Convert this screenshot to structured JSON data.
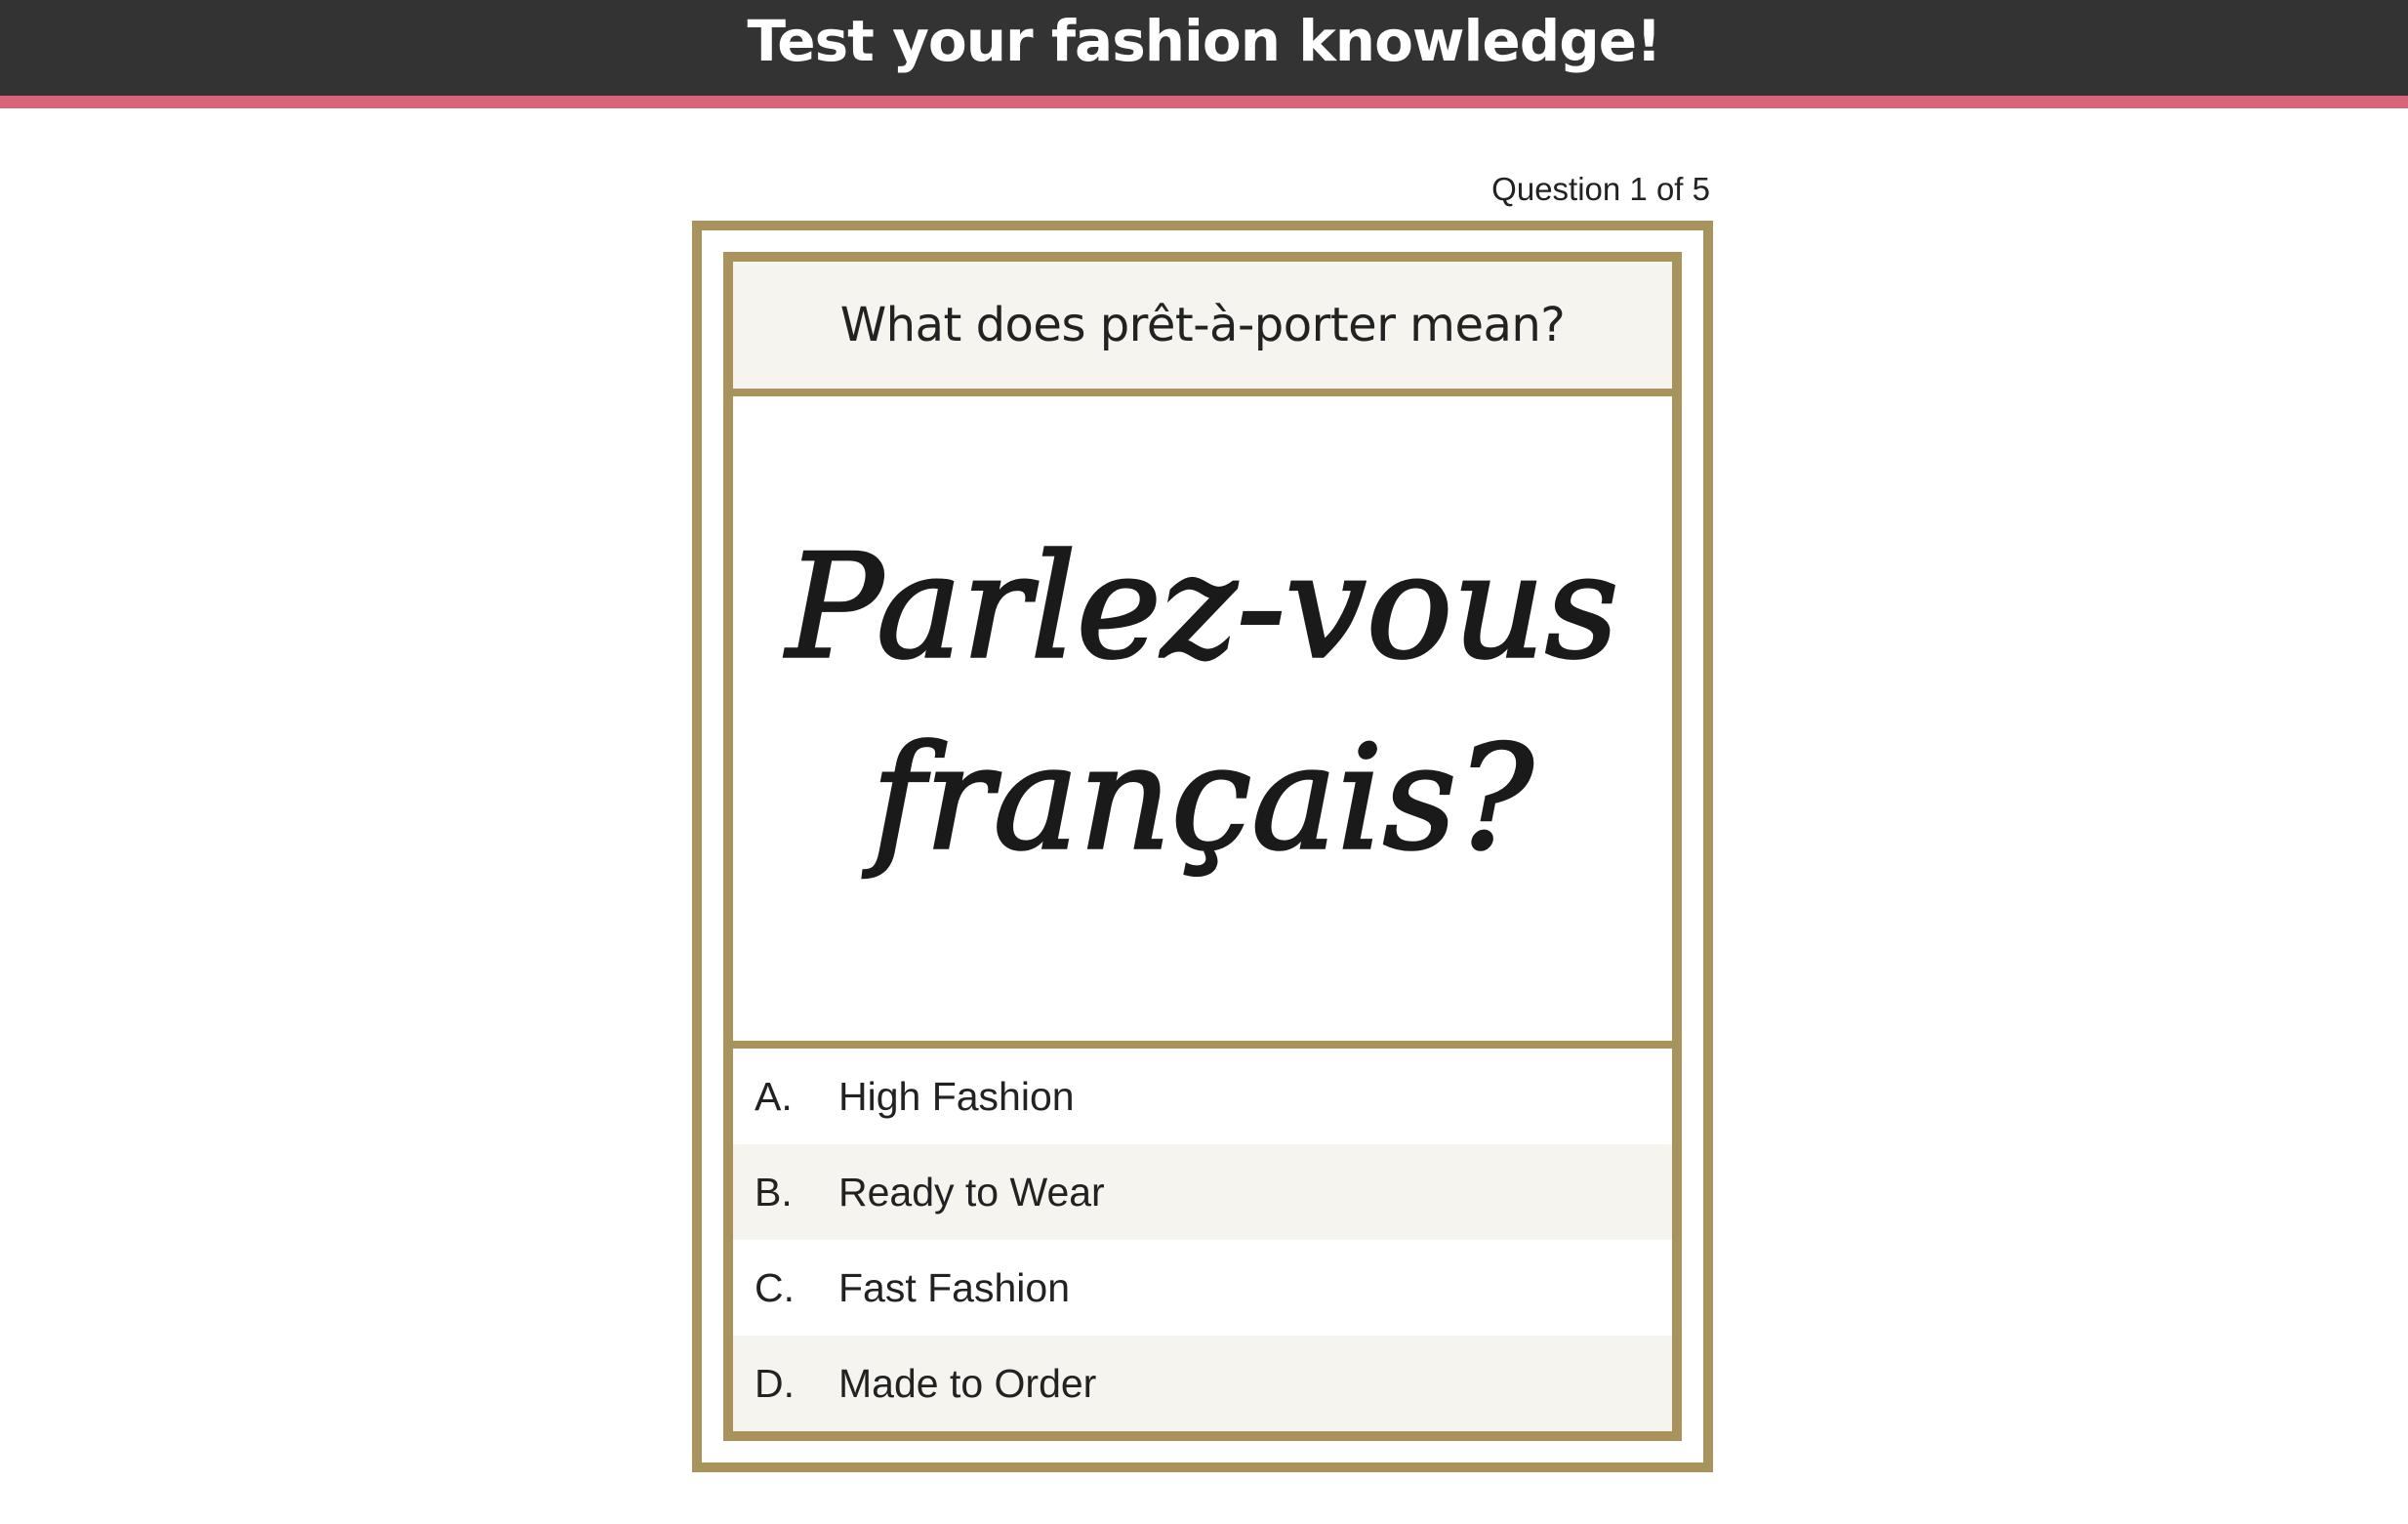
{
  "header": {
    "title": "Test your fashion knowledge!"
  },
  "quiz": {
    "progress": "Question 1 of 5",
    "question": "What does prêt-à-porter mean?",
    "image_text": {
      "line1": "Parlez-vous",
      "line2": "français?"
    },
    "answers": [
      {
        "letter": "A.",
        "text": "High Fashion"
      },
      {
        "letter": "B.",
        "text": "Ready to Wear"
      },
      {
        "letter": "C.",
        "text": "Fast Fashion"
      },
      {
        "letter": "D.",
        "text": "Made to Order"
      }
    ]
  },
  "colors": {
    "topbar": "#333333",
    "accent": "#d9647a",
    "frame": "#a9925c",
    "panel": "#f6f4ee"
  }
}
